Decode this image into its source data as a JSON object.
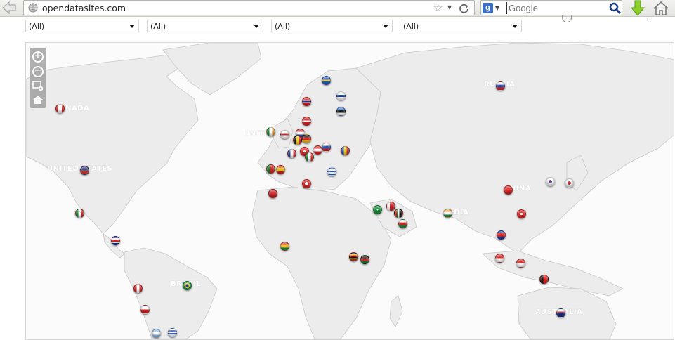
{
  "browser": {
    "url": "opendatasites.com",
    "search_placeholder": "Google"
  },
  "filters": [
    {
      "value": "(All)"
    },
    {
      "value": "(All)"
    },
    {
      "value": "(All)"
    },
    {
      "value": "(All)"
    }
  ],
  "map": {
    "labels": {
      "canada": "CANADA",
      "united_states": "UNITED STATES",
      "united_kingdom": "UNITED K",
      "russia": "RUSSIA",
      "china": "CHINA",
      "india": "INDIA",
      "brazil": "BRAZIL",
      "australia": "AUSTRALIA"
    },
    "controls": [
      "zoom-in-icon",
      "zoom-out-icon",
      "zoom-box-icon",
      "home-extent-icon"
    ],
    "markers": [
      {
        "country": "canada",
        "bg": "linear-gradient(90deg,#d22 0 25%,#fff 25% 75%,#d22 75%)"
      },
      {
        "country": "united-states",
        "bg": "linear-gradient(#2a3a8a 0 45%,#c33 45% 55%,#fff 55% 65%,#c33 65%)"
      },
      {
        "country": "mexico",
        "bg": "linear-gradient(90deg,#1a7a3a 0 33%,#fff 33% 67%,#c22 67%)"
      },
      {
        "country": "costa-rica",
        "bg": "linear-gradient(#1a2a8a 0 20%,#fff 20% 35%,#c22 35% 65%,#fff 65% 80%,#1a2a8a 80%)"
      },
      {
        "country": "peru",
        "bg": "linear-gradient(90deg,#c22 0 33%,#fff 33% 67%,#c22 67%)"
      },
      {
        "country": "chile",
        "bg": "linear-gradient(#fff 0 50%,#c22 50%)"
      },
      {
        "country": "brazil",
        "bg": "radial-gradient(circle,#2a3a8a 0 28%,#f2d02a 29% 48%,#1a8a3a 49%)"
      },
      {
        "country": "argentina",
        "bg": "linear-gradient(#8ab8e8 0 33%,#fff 33% 67%,#8ab8e8 67%)"
      },
      {
        "country": "uruguay",
        "bg": "repeating-linear-gradient(#fff 0 2px,#3a5ab8 2px 4px)"
      },
      {
        "country": "ireland",
        "bg": "linear-gradient(90deg,#1a8a3a 0 33%,#fff 33% 67%,#e88a2a 67%)"
      },
      {
        "country": "united-kingdom",
        "bg": "linear-gradient(#fff 0 40%,#c22 40% 60%,#fff 60%),#1a2a7a"
      },
      {
        "country": "netherlands",
        "bg": "linear-gradient(#c22 0 33%,#fff 33% 67%,#2a4aa8 67%)"
      },
      {
        "country": "belgium",
        "bg": "linear-gradient(90deg,#111 0 33%,#f2d02a 33% 67%,#d22 67%)"
      },
      {
        "country": "germany",
        "bg": "linear-gradient(#111 0 33%,#d22 33% 67%,#f2c01a 67%)"
      },
      {
        "country": "france",
        "bg": "linear-gradient(90deg,#2a3a9a 0 33%,#fff 33% 67%,#d22 67%)"
      },
      {
        "country": "switzerland",
        "bg": "radial-gradient(circle,#fff 0 22%,#d22 23%)"
      },
      {
        "country": "austria",
        "bg": "linear-gradient(#d22 0 33%,#fff 33% 67%,#d22 67%)"
      },
      {
        "country": "italy",
        "bg": "linear-gradient(90deg,#1a8a3a 0 33%,#fff 33% 67%,#d22 67%)"
      },
      {
        "country": "slovakia",
        "bg": "linear-gradient(#fff 0 33%,#2a4aa8 33% 67%,#d22 67%)"
      },
      {
        "country": "moldova",
        "bg": "linear-gradient(90deg,#2a4aa8 0 33%,#f2d02a 33% 67%,#d22 67%)"
      },
      {
        "country": "portugal",
        "bg": "linear-gradient(90deg,#1a7a2a 0 42%,#d22 42%)"
      },
      {
        "country": "spain",
        "bg": "linear-gradient(#c22 0 25%,#f2c01a 25% 75%,#c22 75%)"
      },
      {
        "country": "greece",
        "bg": "repeating-linear-gradient(#2a5ab8 0 2px,#fff 2px 4px)"
      },
      {
        "country": "denmark",
        "bg": "linear-gradient(#c22 0 40%,#fff 40% 60%,#c22 60%)"
      },
      {
        "country": "norway",
        "bg": "linear-gradient(#c22 0 35%,#fff 35% 42%,#1a2a8a 42% 58%,#fff 58% 65%,#c22 65%)"
      },
      {
        "country": "sweden",
        "bg": "linear-gradient(#2a5ab8 0 40%,#f2d02a 40% 60%,#2a5ab8 60%)"
      },
      {
        "country": "finland",
        "bg": "linear-gradient(#fff 0 38%,#1a3aa8 38% 62%,#fff 62%)"
      },
      {
        "country": "estonia",
        "bg": "linear-gradient(#3a7ad8 0 33%,#111 33% 67%,#fff 67%)"
      },
      {
        "country": "russia",
        "bg": "linear-gradient(#fff 0 33%,#2a4aa8 33% 67%,#d22 67%)"
      },
      {
        "country": "tunisia",
        "bg": "radial-gradient(circle,#fff 0 30%,#d22 31%)"
      },
      {
        "country": "morocco",
        "bg": "radial-gradient(circle at 50% 40%,#d33,#a11)"
      },
      {
        "country": "saudi-arabia",
        "bg": "radial-gradient(circle,#fff 0 12%,#1a8a3a 13%)"
      },
      {
        "country": "bahrain",
        "bg": "linear-gradient(90deg,#fff 0 35%,#c22 35%)"
      },
      {
        "country": "uae",
        "bg": "linear-gradient(90deg,#d22 0 28%,#1a8a3a 28% 45%,#fff 45% 60%,#111 60%)"
      },
      {
        "country": "oman",
        "bg": "linear-gradient(#fff 0 33%,#c22 33% 67%,#1a8a3a 67%)"
      },
      {
        "country": "india",
        "bg": "linear-gradient(#f09a3a 0 33%,#fff 33% 67%,#1a8a3a 67%)"
      },
      {
        "country": "ghana",
        "bg": "linear-gradient(#d22 0 33%,#f2c01a 33% 67%,#1a8a3a 67%)"
      },
      {
        "country": "uganda",
        "bg": "linear-gradient(#111 0 17%,#f2c01a 17% 33%,#d22 33% 50%,#111 50% 67%,#f2c01a 67% 83%,#d22 83%)"
      },
      {
        "country": "kenya",
        "bg": "linear-gradient(#111 0 33%,#c22 33% 67%,#1a7a3a 67%)"
      },
      {
        "country": "china",
        "bg": "radial-gradient(circle at 35% 35%,#e33,#b11)"
      },
      {
        "country": "south-korea",
        "bg": "radial-gradient(circle,#c22 0 16%,#2a4aa8 17% 30%,#fff 31%)"
      },
      {
        "country": "japan",
        "bg": "radial-gradient(circle,#c22 0 30%,#fff 31%)"
      },
      {
        "country": "hong-kong",
        "bg": "radial-gradient(circle,#fff 0 22%,#d22 23%)"
      },
      {
        "country": "cambodia",
        "bg": "linear-gradient(#1a3a9a 0 25%,#d22 25% 75%,#1a3a9a 75%)"
      },
      {
        "country": "singapore",
        "bg": "linear-gradient(#d22 0 50%,#fff 50%)"
      },
      {
        "country": "indonesia",
        "bg": "linear-gradient(#d22 0 50%,#fff 50%)"
      },
      {
        "country": "timor-leste",
        "bg": "linear-gradient(90deg,#111 0 40%,#d22 40%)"
      },
      {
        "country": "australia",
        "bg": "linear-gradient(#fff 0 30%,#c22 30% 45%,#1a2a7a 45%)"
      }
    ]
  }
}
